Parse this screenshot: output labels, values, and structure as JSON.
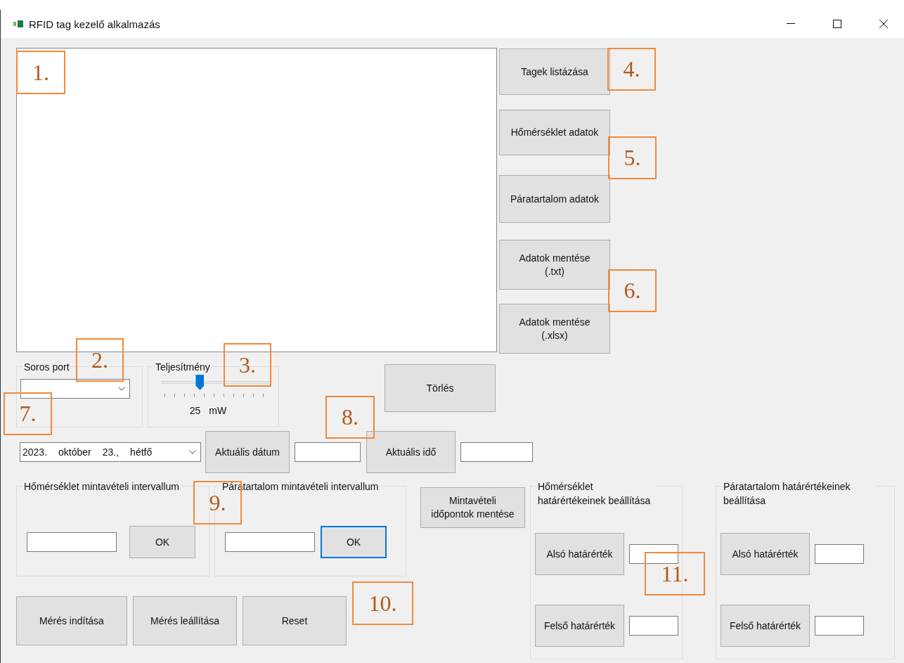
{
  "window": {
    "title": "RFID tag kezelő alkalmazás"
  },
  "side_buttons": [
    "Tagek listázása",
    "Hőmérséklet adatok",
    "Páratartalom adatok",
    "Adatok mentése\n(.txt)",
    "Adatok mentése\n(.xlsx)"
  ],
  "serial_port": {
    "label": "Soros port"
  },
  "power": {
    "label": "Teljesítmény",
    "level": 0.36,
    "value": "25",
    "unit": "mW"
  },
  "clear_button": "Törlés",
  "date_picker": {
    "parts": [
      "2023.",
      "október",
      "23.,",
      "hétfő"
    ]
  },
  "date_button": "Aktuális dátum",
  "time_button": "Aktuális idő",
  "intervals": [
    {
      "title": "Hőmérséklet mintavételi intervallum",
      "button": "OK",
      "focused": false
    },
    {
      "title": "Páratartalom mintavételi intervallum",
      "button": "OK",
      "focused": true
    }
  ],
  "sampling_save_button": "Mintavételi időpontok mentése",
  "limits": [
    {
      "title": "Hőmérséklet határértékeinek beállítása",
      "buttons": [
        "Alsó határérték",
        "Felső határérték"
      ]
    },
    {
      "title": "Páratartalom határértékeinek beállítása",
      "buttons": [
        "Alsó határérték",
        "Felső határérték"
      ]
    }
  ],
  "measure_buttons": [
    "Mérés indítása",
    "Mérés leállítása",
    "Reset"
  ],
  "annotations": [
    {
      "label": "1."
    },
    {
      "label": "2."
    },
    {
      "label": "3."
    },
    {
      "label": "4."
    },
    {
      "label": "5."
    },
    {
      "label": "6."
    },
    {
      "label": "7."
    },
    {
      "label": "8."
    },
    {
      "label": "9."
    },
    {
      "label": "10."
    },
    {
      "label": "11."
    }
  ]
}
